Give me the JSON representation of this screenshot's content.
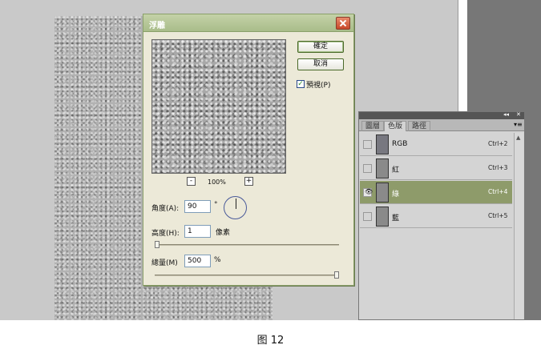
{
  "dialog": {
    "title": "浮雕",
    "ok_label": "確定",
    "cancel_label": "取消",
    "preview_label": "預視(P)",
    "preview_checked": true,
    "zoom": "100%",
    "angle_label": "角度(A):",
    "angle_value": "90",
    "angle_unit": "°",
    "height_label": "高度(H):",
    "height_value": "1",
    "height_unit": "像素",
    "amount_label": "總量(M)",
    "amount_value": "500",
    "amount_unit": "%",
    "height_slider_level": 0.0,
    "amount_slider_level": 1.0
  },
  "panel": {
    "tabs": [
      "圖層",
      "色版",
      "路徑"
    ],
    "active_tab": "色版",
    "channels": [
      {
        "name": "RGB",
        "shortcut": "Ctrl+2",
        "visible": false,
        "selected": false
      },
      {
        "name": "紅",
        "shortcut": "Ctrl+3",
        "visible": false,
        "selected": false
      },
      {
        "name": "綠",
        "shortcut": "Ctrl+4",
        "visible": true,
        "selected": true
      },
      {
        "name": "藍",
        "shortcut": "Ctrl+5",
        "visible": false,
        "selected": false
      }
    ]
  },
  "caption": "图 12"
}
